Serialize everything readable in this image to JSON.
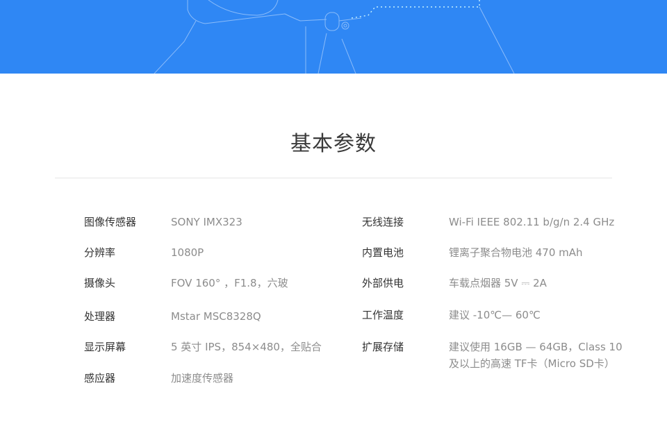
{
  "title": "基本参数",
  "colors": {
    "banner": "#2f87f4",
    "title": "#3a3a3a",
    "label": "#333333",
    "value": "#8c8c8c",
    "divider": "#e6e6e6"
  },
  "specs_left": [
    {
      "label": "图像传感器",
      "value": "SONY IMX323"
    },
    {
      "label": "分辨率",
      "value": "1080P"
    },
    {
      "label": "摄像头",
      "value": "FOV 160° ，F1.8，六玻"
    },
    {
      "label": "处理器",
      "value": "Mstar MSC8328Q"
    },
    {
      "label": "显示屏幕",
      "value": "5 英寸 IPS，854×480，全贴合"
    },
    {
      "label": "感应器",
      "value": "加速度传感器"
    }
  ],
  "specs_right": [
    {
      "label": "无线连接",
      "value": "Wi-Fi IEEE 802.11 b/g/n 2.4 GHz"
    },
    {
      "label": "内置电池",
      "value": "锂离子聚合物电池 470 mAh"
    },
    {
      "label": "外部供电",
      "value": "车载点烟器 5V ⎓ 2A"
    },
    {
      "label": "工作温度",
      "value": "建议 -10℃— 60℃"
    },
    {
      "label": "扩展存储",
      "value": "建议使用 16GB — 64GB，Class 10",
      "value_line2": "及以上的高速 TF卡（Micro SD卡）"
    }
  ]
}
